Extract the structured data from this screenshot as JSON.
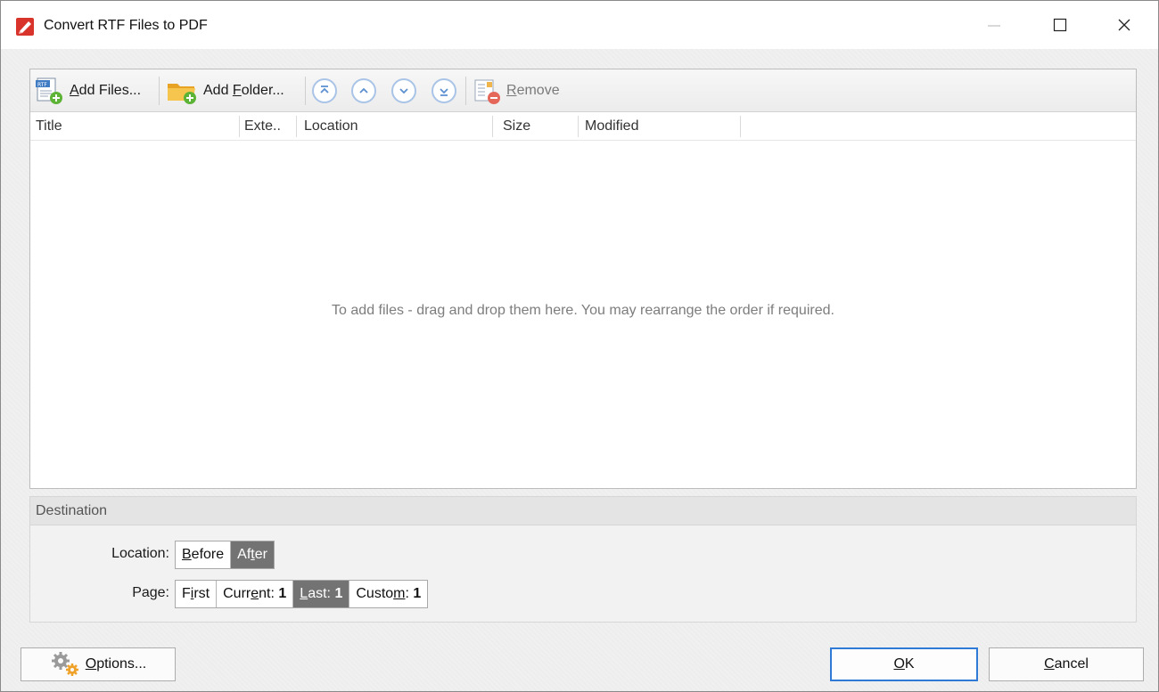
{
  "window": {
    "title": "Convert RTF Files to PDF",
    "controls": {
      "minimize_icon": "minimize-icon",
      "maximize_icon": "maximize-icon",
      "close_icon": "close-icon"
    }
  },
  "toolbar": {
    "add_files": {
      "pre": "",
      "key": "A",
      "post": "dd Files..."
    },
    "add_folder": {
      "pre": "Add ",
      "key": "F",
      "post": "older..."
    },
    "remove": {
      "pre": "",
      "key": "R",
      "post": "emove"
    },
    "nav_icons": [
      "move-to-top-icon",
      "move-up-icon",
      "move-down-icon",
      "move-to-bottom-icon"
    ]
  },
  "file_list": {
    "columns": [
      "Title",
      "Exte..",
      "Location",
      "Size",
      "Modified"
    ],
    "rows": [],
    "empty_message": "To add files - drag and drop them here. You may rearrange the order if required."
  },
  "destination": {
    "header": "Destination",
    "location_label": "Location:",
    "location_options": {
      "before": {
        "pre": "",
        "key": "B",
        "post": "efore"
      },
      "after": {
        "pre": "Af",
        "key": "t",
        "post": "er"
      },
      "selected": "After"
    },
    "page_label": "Page:",
    "page_options": {
      "first": {
        "pre": "F",
        "key": "i",
        "post": "rst"
      },
      "current": {
        "pre": "Curr",
        "key": "e",
        "post": "nt:",
        "value": "1"
      },
      "last": {
        "pre": "",
        "key": "L",
        "post": "ast:",
        "value": "1"
      },
      "custom": {
        "pre": "Custo",
        "key": "m",
        "post": ":",
        "value": "1"
      },
      "selected": "Last"
    }
  },
  "buttons": {
    "options": {
      "pre": "",
      "key": "O",
      "post": "ptions..."
    },
    "ok": {
      "pre": "",
      "key": "O",
      "post": "K"
    },
    "cancel": {
      "pre": "",
      "key": "C",
      "post": "ancel"
    }
  },
  "colors": {
    "accent": "#2f7ad6",
    "selected_segment": "#737373",
    "app_icon": "#d9342b"
  }
}
